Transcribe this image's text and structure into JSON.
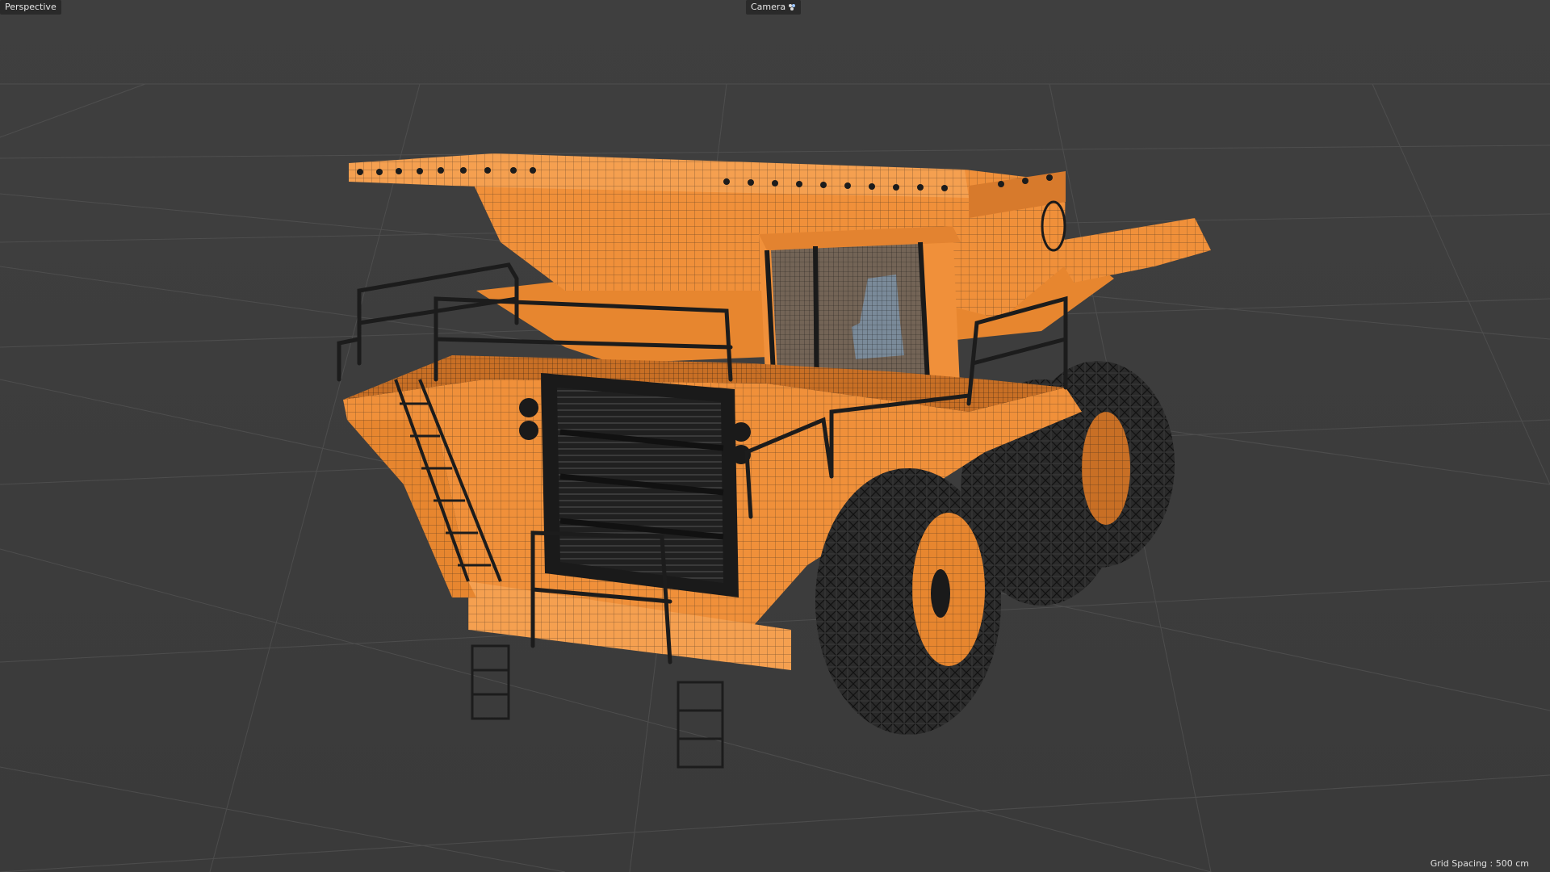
{
  "viewport": {
    "view_label": "Perspective",
    "camera_label": "Camera",
    "camera_icon": "camera-cycle-icon",
    "grid_spacing_label": "Grid Spacing : ",
    "grid_spacing_value": "500 cm"
  },
  "scene": {
    "object": "mining dump truck wireframe model",
    "display_mode": "shaded with wireframe",
    "colors": {
      "background": "#3e3e3e",
      "grid": "#555555",
      "body": "#f0903a",
      "body_shadow": "#c86f25",
      "wire": "#1a1a1a",
      "tire": "#2a2a2a",
      "glass": "#4a5560"
    }
  }
}
